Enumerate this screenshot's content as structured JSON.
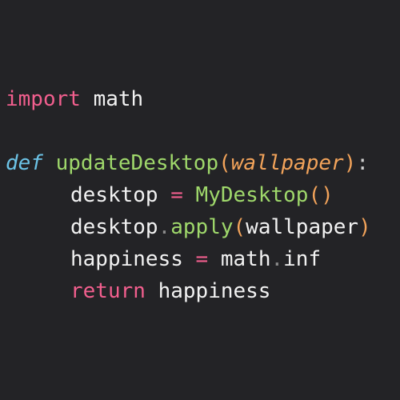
{
  "colors": {
    "background": "#232326",
    "keyword": "#f25f8e",
    "def_keyword": "#6cc3e6",
    "function": "#9fd86b",
    "parameter": "#f2a35a",
    "text": "#f2f2f2"
  },
  "code": {
    "line1": {
      "kw": "import",
      "module": "math"
    },
    "line2": {
      "kw": "def",
      "fn": "updateDesktop",
      "open": "(",
      "param": "wallpaper",
      "close": ")",
      "colon": ":"
    },
    "line3": {
      "var": "desktop",
      "eq": "=",
      "call": "MyDesktop",
      "parens": "()"
    },
    "line4": {
      "obj": "desktop",
      "dot": ".",
      "method": "apply",
      "open": "(",
      "arg": "wallpaper",
      "close": ")"
    },
    "line5": {
      "var": "happiness",
      "eq": "=",
      "obj": "math",
      "dot": ".",
      "attr": "inf"
    },
    "line6": {
      "kw": "return",
      "val": "happiness"
    }
  }
}
